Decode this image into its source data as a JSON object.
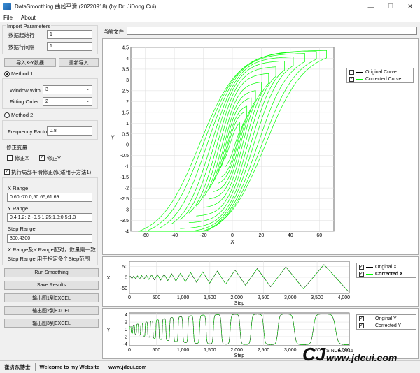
{
  "window": {
    "title": "DataSmoothing 曲线平滑 (20220918) (by Dr. JiDong Cui)",
    "minimize": "—",
    "maximize": "☐",
    "close": "✕"
  },
  "menu": {
    "items": [
      "File",
      "About"
    ]
  },
  "import": {
    "group_title": "Import Parameters",
    "start_row_label": "数据起始行",
    "start_row_value": "1",
    "row_interval_label": "数据行间隔",
    "row_interval_value": "1",
    "import_xy_button": "导入X-Y数据",
    "reimport_button": "重新导入"
  },
  "current_file": {
    "label": "当前文件",
    "value": ""
  },
  "method1": {
    "label": "Method 1",
    "selected": true,
    "window_with_label": "Window With",
    "window_with_value": "3",
    "fitting_order_label": "Fitting Order",
    "fitting_order_value": "2"
  },
  "method2": {
    "label": "Method 2",
    "selected": false,
    "frequency_factor_label": "Frequency Factor",
    "frequency_factor_value": "0.8"
  },
  "correct": {
    "group_title": "修正变量",
    "fix_x_label": "修正X",
    "fix_x_checked": false,
    "fix_y_label": "修正Y",
    "fix_y_checked": true
  },
  "local": {
    "enable_label": "执行局部平滑修正(仅适用于方法1)",
    "enabled": true,
    "x_range_label": "X Range",
    "x_range_value": "0:60;-70:0;50:65;61:69",
    "y_range_label": "Y Range",
    "y_range_value": "0.4:1.2;-2:-0.5;1.25:1.8;0.5:1.3",
    "step_range_label": "Step Range",
    "step_range_value": "300:4300",
    "note_line1": "X Range及Y Range配对，数量需一致",
    "note_line2": "Step Range 用于指定多个Step范围"
  },
  "actions": {
    "run_smoothing": "Run Smoothing",
    "save_results": "Save Results",
    "export1": "输出图1到EXCEL",
    "export2": "输出图2到EXCEL",
    "export3": "输出图3到EXCEL"
  },
  "status": {
    "author": "崔济东博士",
    "welcome": "Welcome to my Website",
    "url": "www.jdcui.com"
  },
  "brand": {
    "since": "SINCE 2015",
    "site": "www.jdcui.com"
  },
  "colors": {
    "original": "#000000",
    "corrected": "#00ff00",
    "accent": "#0078d7"
  },
  "chart_data": [
    {
      "type": "line",
      "name": "hysteresis",
      "xlabel": "X",
      "ylabel": "Y",
      "xlim": [
        -70,
        70
      ],
      "ylim": [
        -4,
        4.5
      ],
      "xticks": [
        "-60",
        "-40",
        "-20",
        "0",
        "20",
        "40",
        "60"
      ],
      "yticks": [
        "-4",
        "-3.5",
        "-3",
        "-2.5",
        "-2",
        "-1.5",
        "-1",
        "-0.5",
        "0",
        "0.5",
        "1",
        "1.5",
        "2",
        "2.5",
        "3",
        "3.5",
        "4",
        "4.5"
      ],
      "legend": {
        "position": "top-right",
        "entries": [
          "Original Curve",
          "Corrected Curve"
        ],
        "checked": [
          false,
          true
        ]
      },
      "series": [
        {
          "name": "Original Curve",
          "color": "#000000",
          "visible": false
        },
        {
          "name": "Corrected Curve",
          "color": "#00ff00",
          "visible": true,
          "cycles_amplitudes_x": [
            5,
            8,
            10,
            13,
            16,
            20,
            25,
            30,
            36,
            42,
            50,
            58,
            65
          ]
        }
      ]
    },
    {
      "type": "line",
      "name": "x-vs-step",
      "xlabel": "Step",
      "ylabel": "X",
      "xlim": [
        0,
        4100
      ],
      "ylim": [
        -75,
        75
      ],
      "xticks": [
        "0",
        "500",
        "1,000",
        "1,500",
        "2,000",
        "2,500",
        "3,000",
        "3,500",
        "4,000"
      ],
      "yticks": [
        "-50",
        "0",
        "50"
      ],
      "legend": {
        "position": "right",
        "entries": [
          "Original X",
          "Corrected X"
        ],
        "checked": [
          true,
          true
        ]
      },
      "series": [
        {
          "name": "Original X",
          "color": "#000000"
        },
        {
          "name": "Corrected X",
          "color": "#00ff00"
        }
      ]
    },
    {
      "type": "line",
      "name": "y-vs-step",
      "xlabel": "Step",
      "ylabel": "Y",
      "xlim": [
        0,
        4100
      ],
      "ylim": [
        -4.5,
        4.5
      ],
      "xticks": [
        "0",
        "500",
        "1,000",
        "1,500",
        "2,000",
        "2,500",
        "3,000",
        "3,500",
        "4,000"
      ],
      "yticks": [
        "-4",
        "-2",
        "0",
        "2",
        "4"
      ],
      "legend": {
        "position": "right",
        "entries": [
          "Original Y",
          "Corrected Y"
        ],
        "checked": [
          true,
          true
        ]
      },
      "series": [
        {
          "name": "Original Y",
          "color": "#000000"
        },
        {
          "name": "Corrected Y",
          "color": "#00ff00"
        }
      ]
    }
  ]
}
